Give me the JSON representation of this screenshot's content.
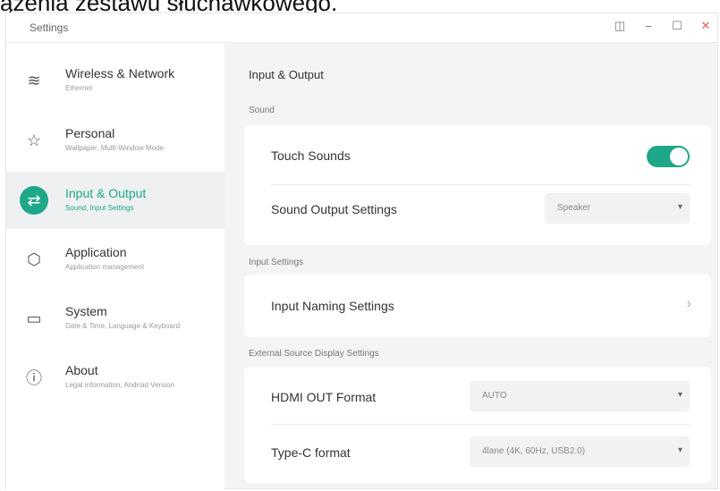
{
  "caption": "ązenia zestawu słuchawkowego.",
  "window": {
    "title": "Settings",
    "buttons": {
      "split": "◫",
      "minimize": "−",
      "maximize": "☐",
      "close": "✕"
    }
  },
  "sidebar": {
    "items": [
      {
        "title": "Wireless & Network",
        "subtitle": "Ethernet",
        "icon": "wifi-icon",
        "glyph": "≋"
      },
      {
        "title": "Personal",
        "subtitle": "Wallpaper, Multi-Window Mode",
        "icon": "star-icon",
        "glyph": "☆"
      },
      {
        "title": "Input & Output",
        "subtitle": "Sound, Input Settings",
        "icon": "swap-arrows-icon",
        "glyph": "⇄",
        "active": true
      },
      {
        "title": "Application",
        "subtitle": "Application management",
        "icon": "cube-icon",
        "glyph": "⬡"
      },
      {
        "title": "System",
        "subtitle": "Date & Time, Language & Keyboard",
        "icon": "monitor-icon",
        "glyph": "▭"
      },
      {
        "title": "About",
        "subtitle": "Legal information, Android Version",
        "icon": "info-icon",
        "glyph": "ⓘ"
      }
    ]
  },
  "content": {
    "page_title": "Input & Output",
    "sound": {
      "section_label": "Sound",
      "touch_sounds_label": "Touch Sounds",
      "touch_sounds_on": true,
      "sound_output_label": "Sound Output Settings",
      "sound_output_value": "Speaker"
    },
    "input_settings": {
      "section_label": "Input Settings",
      "input_naming_label": "Input Naming Settings",
      "chevron": "›"
    },
    "external": {
      "section_label": "External Source Display Settings",
      "hdmi_label": "HDMI OUT Format",
      "hdmi_value": "AUTO",
      "typec_label": "Type-C format",
      "typec_value": "4lane (4K, 60Hz, USB2.0)"
    },
    "dropdown_arrow": "▾"
  },
  "colors": {
    "accent": "#1ea789"
  }
}
